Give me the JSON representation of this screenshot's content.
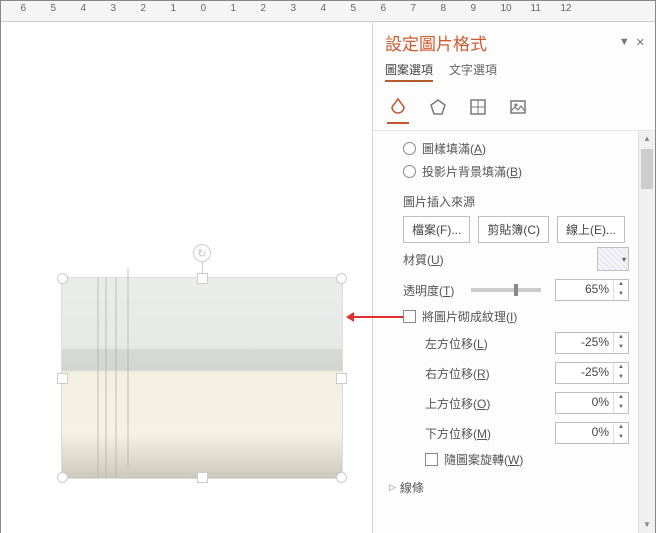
{
  "panel": {
    "title": "設定圖片格式",
    "tabs": {
      "shape_options": "圖案選項",
      "text_options": "文字選項"
    },
    "fill": {
      "pattern_fill": "圖樣填滿(A)",
      "slide_bg_fill": "投影片背景填滿(B)",
      "insert_from": "圖片插入來源",
      "file_btn": "檔案(F)...",
      "clipboard_btn": "剪貼簿(C)",
      "online_btn": "線上(E)...",
      "texture": "材質(U)",
      "transparency": "透明度(T)",
      "transparency_value": "65%",
      "tile_as_texture": "將圖片砌成紋理(I)",
      "offset_left": "左方位移(L)",
      "offset_left_value": "-25%",
      "offset_right": "右方位移(R)",
      "offset_right_value": "-25%",
      "offset_top": "上方位移(O)",
      "offset_top_value": "0%",
      "offset_bottom": "下方位移(M)",
      "offset_bottom_value": "0%",
      "rotate_with_shape": "隨圖案旋轉(W)"
    },
    "line_section": "線條"
  },
  "ruler": [
    "6",
    "5",
    "4",
    "3",
    "2",
    "1",
    "0",
    "1",
    "2",
    "3",
    "4",
    "5",
    "6",
    "7",
    "8",
    "9",
    "10",
    "11",
    "12"
  ]
}
